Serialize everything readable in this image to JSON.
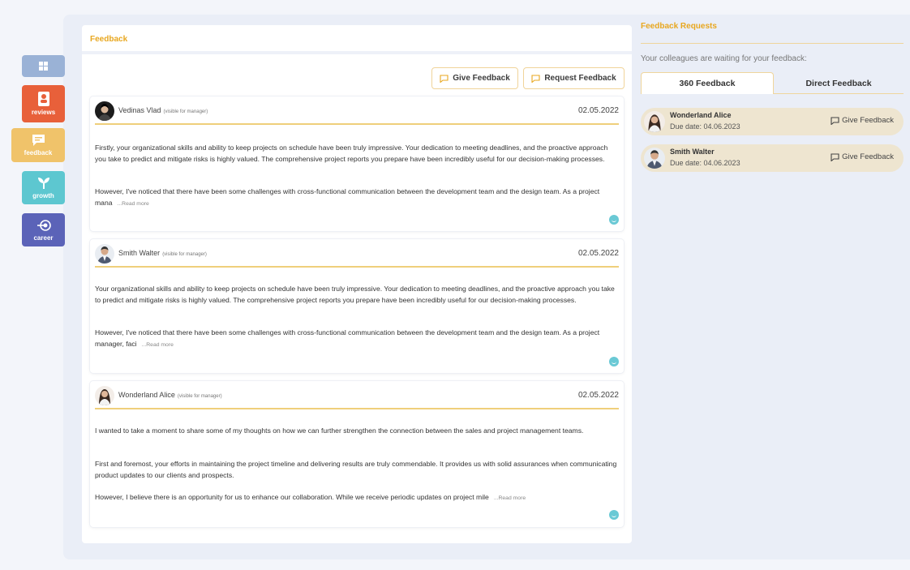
{
  "sidebar": {
    "items": [
      {
        "label": "",
        "icon": "dashboard-icon",
        "color": "#9ab2d6"
      },
      {
        "label": "reviews",
        "icon": "reviews-icon",
        "color": "#e8603a"
      },
      {
        "label": "feedback",
        "icon": "feedback-icon",
        "color": "#f0c36a"
      },
      {
        "label": "growth",
        "icon": "growth-icon",
        "color": "#5dc7d0"
      },
      {
        "label": "career",
        "icon": "career-icon",
        "color": "#5b63b8"
      }
    ]
  },
  "main": {
    "title": "Feedback",
    "give_feedback_label": "Give Feedback",
    "request_feedback_label": "Request Feedback",
    "cards": [
      {
        "author": "Vedinas Vlad",
        "visibility": "(visible for manager)",
        "date": "02.05.2022",
        "paragraphs": [
          "Firstly, your organizational skills and ability to keep projects on schedule have been truly impressive. Your dedication to meeting deadlines, and the proactive approach you take to predict and mitigate risks is highly valued. The comprehensive project reports you prepare have been incredibly useful for our decision-making processes.",
          "However, I've noticed that there have been some challenges with cross-functional communication between the development team and the design team. As a project mana"
        ],
        "read_more": "...Read more"
      },
      {
        "author": "Smith Walter",
        "visibility": "(visible for manager)",
        "date": "02.05.2022",
        "paragraphs": [
          "Your organizational skills and ability to keep projects on schedule have been truly impressive. Your dedication to meeting deadlines, and the proactive approach you take to predict and mitigate risks is highly valued. The comprehensive project reports you prepare have been incredibly useful for our decision-making processes.",
          "However, I've noticed that there have been some challenges with cross-functional communication between the development team and the design team. As a project manager, faci"
        ],
        "read_more": "...Read more"
      },
      {
        "author": "Wonderland Alice",
        "visibility": "(visible for manager)",
        "date": "02.05.2022",
        "paragraphs": [
          "I wanted to take a moment to share some of my thoughts on how we can further strengthen the connection between the sales and project management teams.",
          "First and foremost, your efforts in maintaining the project timeline and delivering results are truly commendable. It provides us with solid assurances when communicating product updates to our clients and prospects.",
          "However, I believe there is an opportunity for us to enhance our collaboration. While we receive periodic updates on project mile"
        ],
        "read_more": "...Read more"
      }
    ]
  },
  "requests": {
    "title": "Feedback Requests",
    "subtitle": "Your colleagues are waiting for your feedback:",
    "tabs": [
      "360 Feedback",
      "Direct Feedback"
    ],
    "items": [
      {
        "name": "Wonderland Alice",
        "due": "Due date: 04.06.2023",
        "action": "Give Feedback"
      },
      {
        "name": "Smith Walter",
        "due": "Due date: 04.06.2023",
        "action": "Give Feedback"
      }
    ]
  },
  "colors": {
    "accent": "#e8a71f",
    "rule": "#efcf7b",
    "emoji": "#6ac9d5"
  }
}
